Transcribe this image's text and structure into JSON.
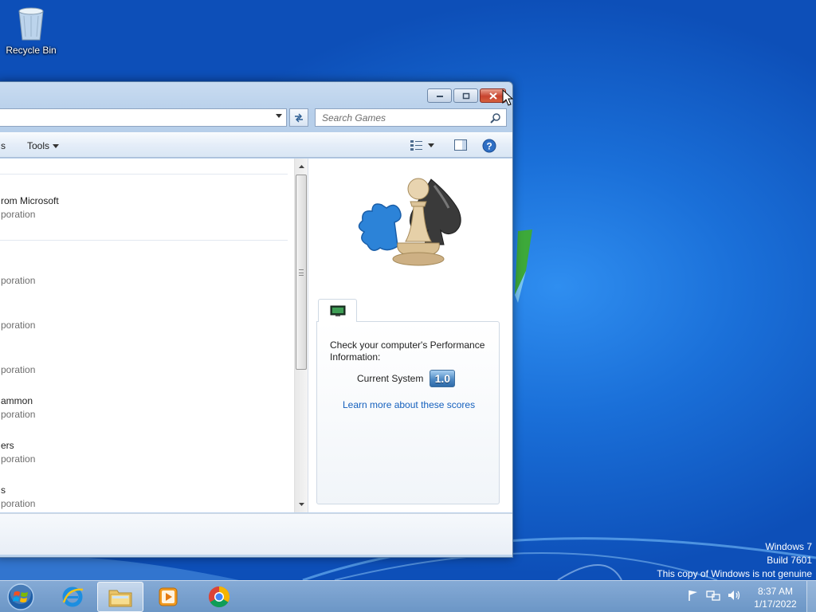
{
  "desktop": {
    "recycle_bin_label": "Recycle Bin",
    "watermark": {
      "line1": "Windows 7",
      "line2": "Build 7601",
      "line3": "This copy of Windows is not genuine"
    }
  },
  "window": {
    "search_placeholder": "Search Games",
    "toolbar": {
      "partial_left_label": "s",
      "tools_label": "Tools"
    },
    "games": [
      {
        "name": "rom Microsoft",
        "publisher": "poration"
      },
      {
        "name": "",
        "publisher": "poration"
      },
      {
        "name": "",
        "publisher": "poration"
      },
      {
        "name": "",
        "publisher": "poration"
      },
      {
        "name": "ammon",
        "publisher": "poration"
      },
      {
        "name": "ers",
        "publisher": "poration"
      },
      {
        "name": "s",
        "publisher": "poration"
      }
    ],
    "details": {
      "perf_title": "Check your computer's Performance Information:",
      "current_system_label": "Current System",
      "score": "1.0",
      "learn_more_link": "Learn more about these scores"
    }
  },
  "taskbar": {
    "clock_time": "8:37 AM",
    "clock_date": "1/17/2022"
  },
  "colors": {
    "desktop_blue": "#1a6fd8",
    "link_blue": "#1560bd",
    "close_red": "#c8432e"
  }
}
